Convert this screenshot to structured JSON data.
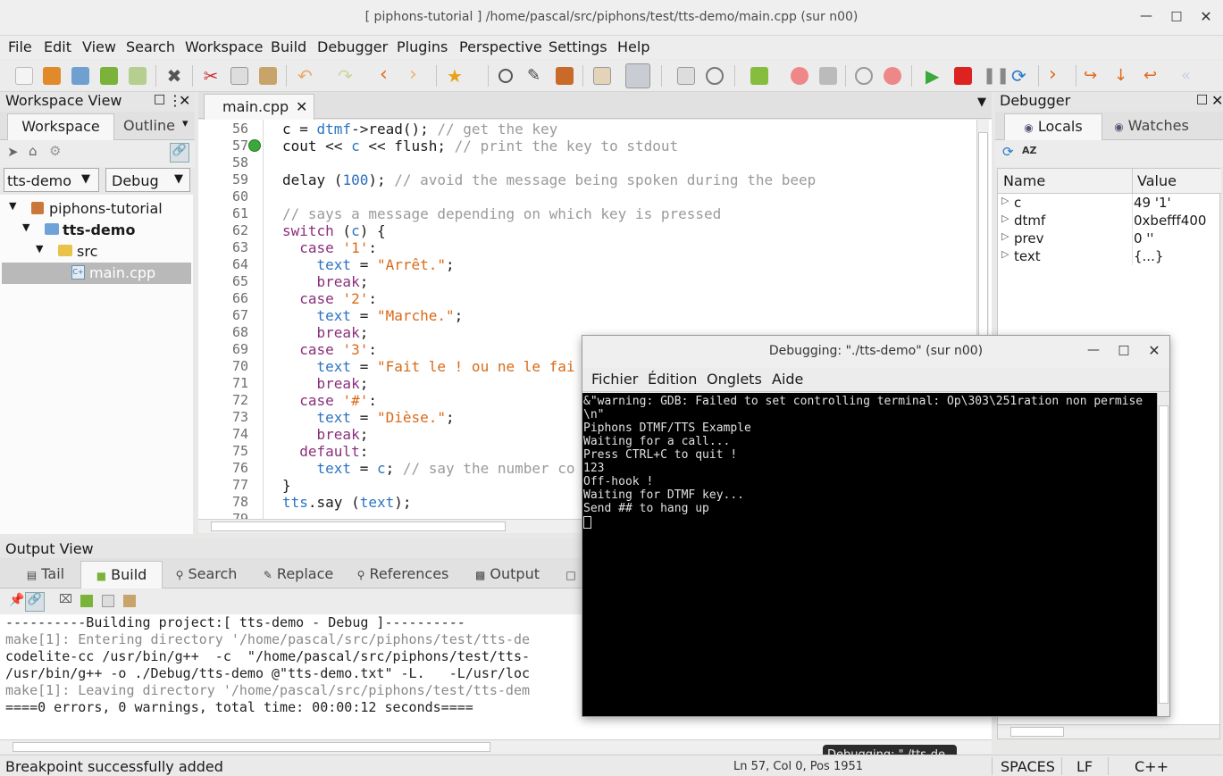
{
  "window": {
    "title": "[ piphons-tutorial ] /home/pascal/src/piphons/test/tts-demo/main.cpp (sur n00)"
  },
  "menu": [
    "File",
    "Edit",
    "View",
    "Search",
    "Workspace",
    "Build",
    "Debugger",
    "Plugins",
    "Perspective",
    "Settings",
    "Help"
  ],
  "workspace": {
    "title": "Workspace View",
    "tabs": [
      "Workspace",
      "Outline"
    ],
    "project_select": "tts-demo",
    "config_select": "Debug",
    "tree": [
      {
        "label": "piphons-tutorial"
      },
      {
        "label": "tts-demo"
      },
      {
        "label": "src"
      },
      {
        "label": "main.cpp"
      }
    ]
  },
  "editor": {
    "tab": "main.cpp",
    "line_numbers": [
      "56",
      "57",
      "58",
      "59",
      "60",
      "61",
      "62",
      "63",
      "64",
      "65",
      "66",
      "67",
      "68",
      "69",
      "70",
      "71",
      "72",
      "73",
      "74",
      "75",
      "76",
      "77",
      "78",
      "79"
    ]
  },
  "debugger": {
    "title": "Debugger",
    "tabs": [
      "Locals",
      "Watches"
    ],
    "columns": [
      "Name",
      "Value"
    ],
    "locals": [
      {
        "name": "c",
        "value": "49 '1'"
      },
      {
        "name": "dtmf",
        "value": "0xbefff400"
      },
      {
        "name": "prev",
        "value": "0 ''"
      },
      {
        "name": "text",
        "value": "{...}"
      }
    ]
  },
  "output": {
    "title": "Output View",
    "tabs": [
      "Tail",
      "Build",
      "Search",
      "Replace",
      "References",
      "Output"
    ],
    "lines": [
      "----------Building project:[ tts-demo - Debug ]----------",
      "make[1]: Entering directory '/home/pascal/src/piphons/test/tts-de",
      "codelite-cc /usr/bin/g++  -c  \"/home/pascal/src/piphons/test/tts-",
      "/usr/bin/g++ -o ./Debug/tts-demo @\"tts-demo.txt\" -L.   -L/usr/loc",
      "make[1]: Leaving directory '/home/pascal/src/piphons/test/tts-dem",
      "====0 errors, 0 warnings, total time: 00:00:12 seconds===="
    ]
  },
  "terminal": {
    "title": "Debugging: \"./tts-demo\"  (sur n00)",
    "menu": [
      "Fichier",
      "Édition",
      "Onglets",
      "Aide"
    ],
    "lines": [
      "&\"warning: GDB: Failed to set controlling terminal: Op\\303\\251ration non permise",
      "\\n\"",
      "Piphons DTMF/TTS Example",
      "Waiting for a call...",
      "Press CTRL+C to quit !",
      "123",
      "Off-hook !",
      "Waiting for DTMF key...",
      "Send ## to hang up"
    ]
  },
  "tooltip": "Debugging: \"./tts-de...",
  "status": {
    "message": "Breakpoint successfully added",
    "position": "Ln 57, Col 0, Pos 1951",
    "indent": "SPACES",
    "eol": "LF",
    "lang": "C++"
  },
  "colors": {
    "accent": "#3a86c8",
    "keyword": "#8a2f7a",
    "string": "#d86a18",
    "comment": "#9a9a9a"
  }
}
